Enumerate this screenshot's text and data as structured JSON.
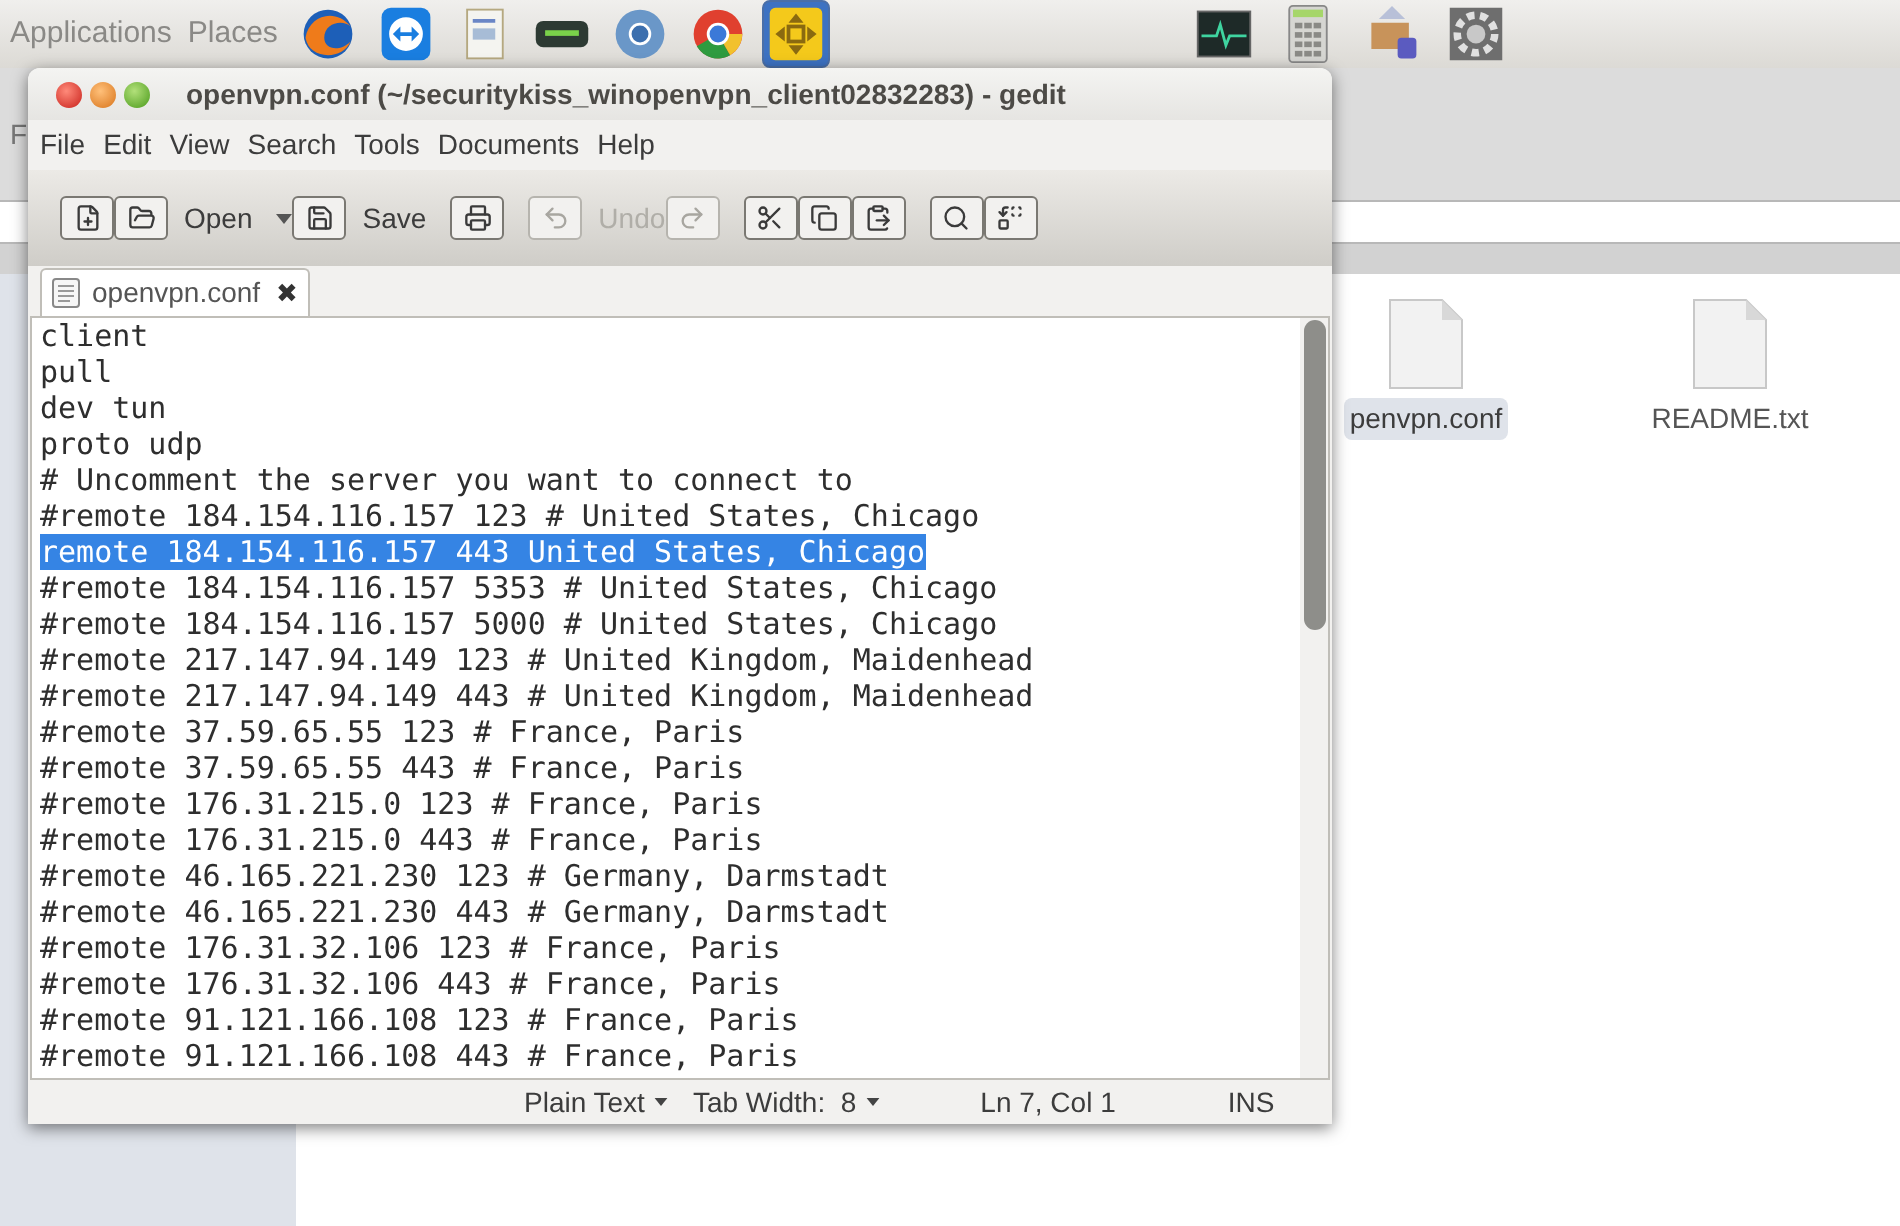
{
  "top_panel": {
    "menus": [
      "Applications",
      "Places"
    ],
    "launchers": [
      {
        "kind": "firefox"
      },
      {
        "kind": "teamviewer"
      },
      {
        "kind": "document"
      },
      {
        "kind": "xbmc"
      },
      {
        "kind": "chromium"
      },
      {
        "kind": "chrome"
      },
      {
        "kind": "vmware",
        "selected": true
      }
    ],
    "indicators": [
      {
        "kind": "monitor"
      },
      {
        "kind": "calculator"
      },
      {
        "kind": "package"
      },
      {
        "kind": "gear"
      }
    ]
  },
  "file_manager": {
    "menu_partial": "F",
    "files": [
      {
        "name": "penvpn.conf",
        "selected": true
      },
      {
        "name": "README.txt",
        "selected": false
      }
    ]
  },
  "window": {
    "title": "openvpn.conf (~/securitykiss_winopenvpn_client02832283) - gedit",
    "menus": [
      "File",
      "Edit",
      "View",
      "Search",
      "Tools",
      "Documents",
      "Help"
    ],
    "toolbar": [
      {
        "kind": "new",
        "disabled": false
      },
      {
        "kind": "open",
        "label": "Open",
        "disabled": false
      },
      {
        "kind": "save",
        "label": "Save",
        "disabled": false
      },
      {
        "kind": "print",
        "disabled": false
      },
      {
        "kind": "undo",
        "label": "Undo",
        "disabled": true
      },
      {
        "kind": "redo",
        "disabled": true
      },
      {
        "kind": "cut",
        "disabled": false
      },
      {
        "kind": "copy",
        "disabled": false
      },
      {
        "kind": "paste",
        "disabled": false
      },
      {
        "kind": "find",
        "disabled": false
      },
      {
        "kind": "replace",
        "disabled": false
      }
    ]
  },
  "tabs": [
    {
      "label": "openvpn.conf",
      "close": "✖",
      "selected": true
    }
  ],
  "editor": {
    "lines": [
      {
        "text": "client",
        "selected": false
      },
      {
        "text": "pull",
        "selected": false
      },
      {
        "text": "dev tun",
        "selected": false
      },
      {
        "text": "proto udp",
        "selected": false
      },
      {
        "text": "# Uncomment the server you want to connect to",
        "selected": false
      },
      {
        "text": "#remote 184.154.116.157 123 # United States, Chicago",
        "selected": false
      },
      {
        "text": "remote 184.154.116.157 443 United States, Chicago",
        "selected": true
      },
      {
        "text": "#remote 184.154.116.157 5353 # United States, Chicago",
        "selected": false
      },
      {
        "text": "#remote 184.154.116.157 5000 # United States, Chicago",
        "selected": false
      },
      {
        "text": "#remote 217.147.94.149 123 # United Kingdom, Maidenhead",
        "selected": false
      },
      {
        "text": "#remote 217.147.94.149 443 # United Kingdom, Maidenhead",
        "selected": false
      },
      {
        "text": "#remote 37.59.65.55 123 # France, Paris",
        "selected": false
      },
      {
        "text": "#remote 37.59.65.55 443 # France, Paris",
        "selected": false
      },
      {
        "text": "#remote 176.31.215.0 123 # France, Paris",
        "selected": false
      },
      {
        "text": "#remote 176.31.215.0 443 # France, Paris",
        "selected": false
      },
      {
        "text": "#remote 46.165.221.230 123 # Germany, Darmstadt",
        "selected": false
      },
      {
        "text": "#remote 46.165.221.230 443 # Germany, Darmstadt",
        "selected": false
      },
      {
        "text": "#remote 176.31.32.106 123 # France, Paris",
        "selected": false
      },
      {
        "text": "#remote 176.31.32.106 443 # France, Paris",
        "selected": false
      },
      {
        "text": "#remote 91.121.166.108 123 # France, Paris",
        "selected": false
      },
      {
        "text": "#remote 91.121.166.108 443 # France, Paris",
        "selected": false
      }
    ]
  },
  "status_bar": {
    "language": "Plain Text",
    "tab_width": "Tab Width:  8",
    "position": "Ln 7, Col 1",
    "mode": "INS"
  }
}
